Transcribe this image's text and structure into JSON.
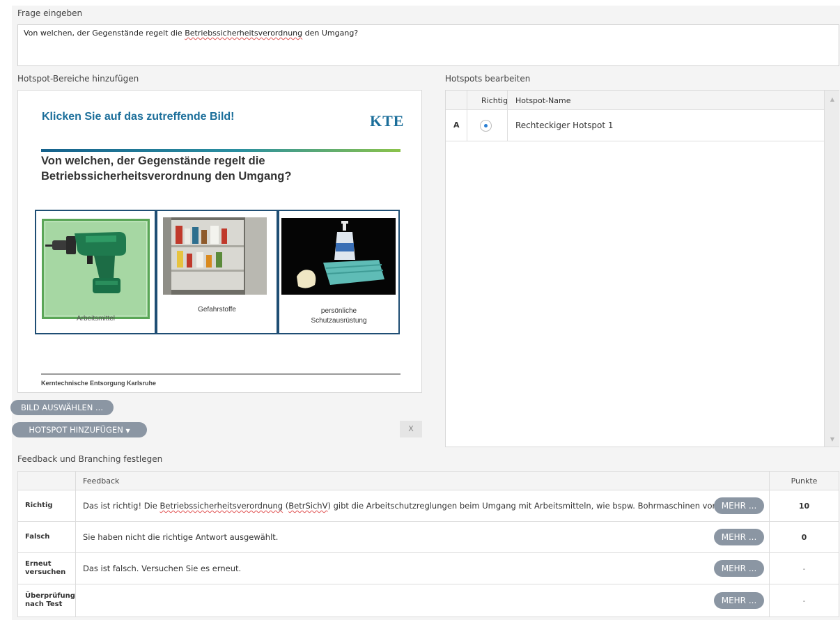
{
  "question": {
    "label": "Frage eingeben",
    "text_before": "Von welchen, der Gegenstände regelt die ",
    "text_misspelled": "Betriebssicherheitsverordnung",
    "text_after": " den Umgang?"
  },
  "hotspot_area": {
    "label": "Hotspot-Bereiche hinzufügen",
    "slide": {
      "title": "Klicken Sie auf das zutreffende Bild!",
      "logo": "KTE",
      "question_line1": "Von welchen, der Gegenstände regelt die",
      "question_line2": "Betriebssicherheitsverordnung den Umgang?",
      "cards": [
        {
          "caption": "Arbeitsmittel",
          "image": "drill-image",
          "highlighted": true
        },
        {
          "caption": "Gefahrstoffe",
          "image": "cabinet-image",
          "highlighted": false
        },
        {
          "caption_line1": "persönliche",
          "caption_line2": "Schutzausrüstung",
          "image": "ppe-image",
          "highlighted": false
        }
      ],
      "footer": "Kerntechnische Entsorgung Karlsruhe"
    },
    "select_image_button": "BILD AUSWÄHLEN ...",
    "add_hotspot_button": "HOTSPOT HINZUFÜGEN",
    "add_hotspot_caret": "▼",
    "delete_button": "X"
  },
  "hotspot_edit": {
    "label": "Hotspots bearbeiten",
    "columns": {
      "correct": "Richtig",
      "name": "Hotspot-Name"
    },
    "rows": [
      {
        "letter": "A",
        "correct": true,
        "name": "Rechteckiger Hotspot 1"
      }
    ],
    "scroll_up": "▲",
    "scroll_down": "▼"
  },
  "feedback": {
    "label": "Feedback und Branching festlegen",
    "columns": {
      "feedback": "Feedback",
      "points": "Punkte"
    },
    "more_label": "MEHR ...",
    "rows": [
      {
        "label_line1": "Richtig",
        "label_line2": "",
        "text_before": "Das ist richtig! Die ",
        "text_sq1": "Betriebssicherheitsverordnung",
        "text_mid": " (",
        "text_sq2": "BetrSichV",
        "text_after": ") gibt die Arbeitschutzreglungen beim Umgang mit Arbeitsmitteln, wie bspw. Bohrmaschinen vor",
        "points": "10"
      },
      {
        "label_line1": "Falsch",
        "label_line2": "",
        "text": "Sie haben nicht die richtige Antwort ausgewählt.",
        "points": "0"
      },
      {
        "label_line1": "Erneut",
        "label_line2": "versuchen",
        "text": "Das ist falsch. Versuchen Sie es erneut.",
        "points": "-"
      },
      {
        "label_line1": "Überprüfung",
        "label_line2": "nach Test",
        "text": "",
        "points": "-"
      }
    ]
  },
  "colors": {
    "accent_blue": "#1b6e9a",
    "button_gray": "#8b96a3",
    "hotspot_green": "#a6d7a3",
    "radio_blue": "#2a7fd4"
  }
}
